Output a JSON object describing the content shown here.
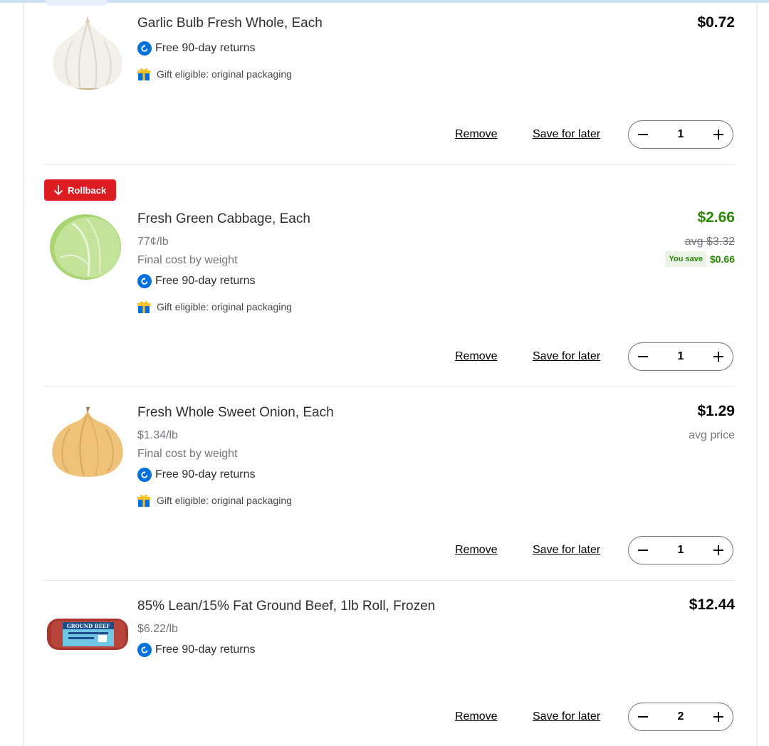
{
  "colors": {
    "accent_blue": "#0071dc",
    "rollback_red": "#de1c24",
    "savings_green": "#2a8703"
  },
  "actions": {
    "remove_label": "Remove",
    "save_later_label": "Save for later"
  },
  "badges": {
    "rollback_label": "Rollback"
  },
  "common": {
    "returns_text": "Free 90-day returns",
    "gift_text": "Gift eligible: original packaging",
    "final_cost_text": "Final cost by weight"
  },
  "items": [
    {
      "title": "Garlic Bulb Fresh Whole, Each",
      "price": "$0.72",
      "quantity": "1",
      "image_icon": "garlic-image"
    },
    {
      "title": "Fresh Green Cabbage, Each",
      "unit_price": "77¢/lb",
      "price": "$2.66",
      "avg_price": "avg $3.32",
      "you_save_label": "You save",
      "you_save_amount": "$0.66",
      "quantity": "1",
      "image_icon": "cabbage-image"
    },
    {
      "title": "Fresh Whole Sweet Onion, Each",
      "unit_price": "$1.34/lb",
      "price": "$1.29",
      "avg_price": "avg price",
      "quantity": "1",
      "image_icon": "onion-image"
    },
    {
      "title": "85% Lean/15% Fat Ground Beef, 1lb Roll, Frozen",
      "unit_price": "$6.22/lb",
      "price": "$12.44",
      "quantity": "2",
      "image_icon": "ground-beef-image",
      "package_text": "GROUND BEEF"
    }
  ]
}
